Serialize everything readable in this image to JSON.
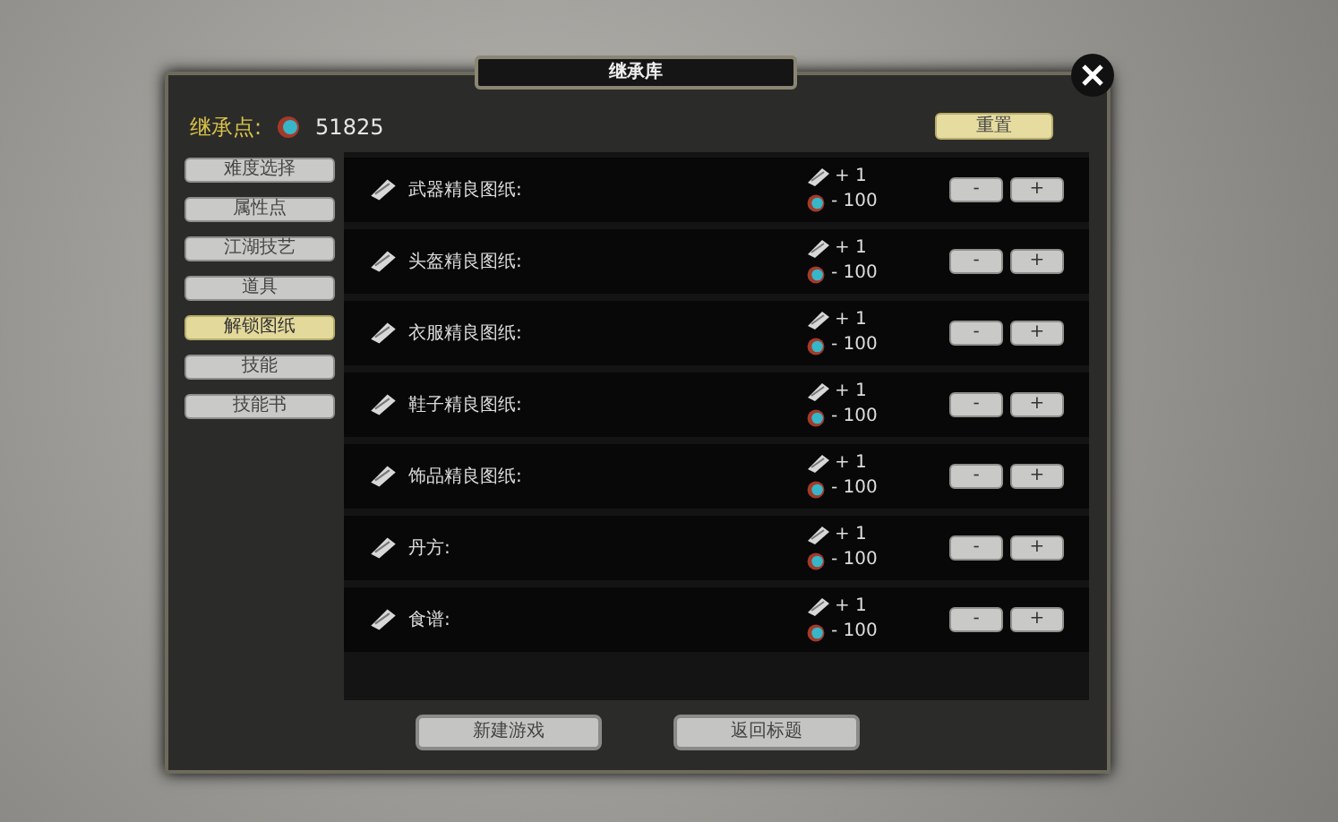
{
  "window": {
    "title": "继承库"
  },
  "points": {
    "label": "继承点:",
    "value": "51825"
  },
  "reset_button": "重置",
  "menu": [
    {
      "label": "难度选择",
      "selected": false
    },
    {
      "label": "属性点",
      "selected": false
    },
    {
      "label": "江湖技艺",
      "selected": false
    },
    {
      "label": "道具",
      "selected": false
    },
    {
      "label": "解锁图纸",
      "selected": true
    },
    {
      "label": "技能",
      "selected": false
    },
    {
      "label": "技能书",
      "selected": false
    }
  ],
  "rows": [
    {
      "name": "武器精良图纸:",
      "gain": "+ 1",
      "cost": "- 100",
      "minus": "-",
      "plus": "+"
    },
    {
      "name": "头盔精良图纸:",
      "gain": "+ 1",
      "cost": "- 100",
      "minus": "-",
      "plus": "+"
    },
    {
      "name": "衣服精良图纸:",
      "gain": "+ 1",
      "cost": "- 100",
      "minus": "-",
      "plus": "+"
    },
    {
      "name": "鞋子精良图纸:",
      "gain": "+ 1",
      "cost": "- 100",
      "minus": "-",
      "plus": "+"
    },
    {
      "name": "饰品精良图纸:",
      "gain": "+ 1",
      "cost": "- 100",
      "minus": "-",
      "plus": "+"
    },
    {
      "name": "丹方:",
      "gain": "+ 1",
      "cost": "- 100",
      "minus": "-",
      "plus": "+"
    },
    {
      "name": "食谱:",
      "gain": "+ 1",
      "cost": "- 100",
      "minus": "-",
      "plus": "+"
    }
  ],
  "footer_buttons": [
    "新建游戏",
    "返回标题"
  ]
}
